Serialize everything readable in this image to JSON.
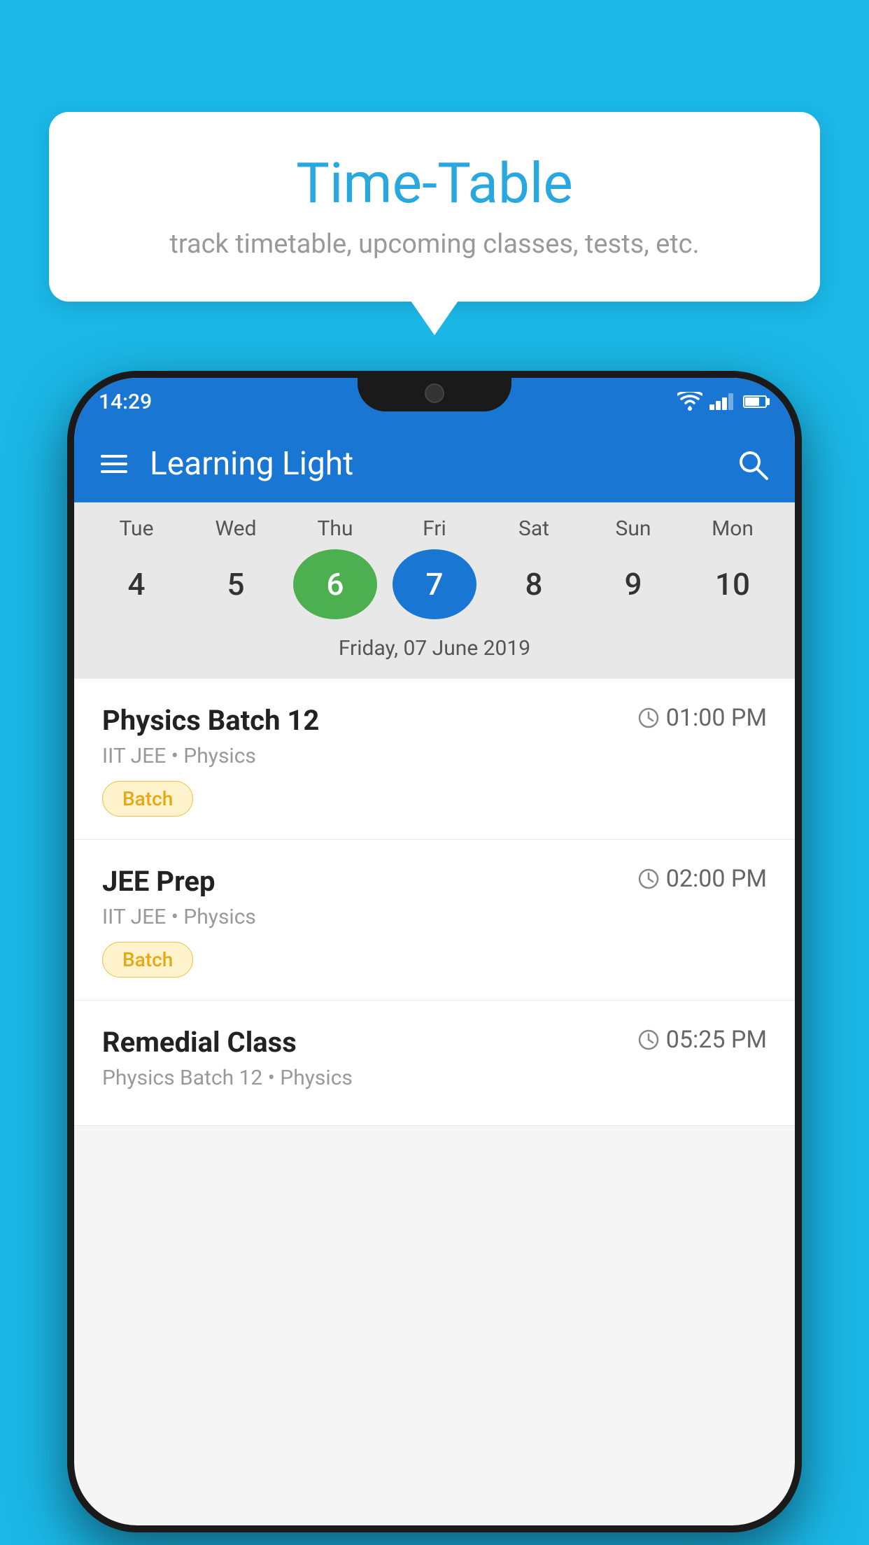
{
  "background_color": "#1BB8E8",
  "tooltip": {
    "title": "Time-Table",
    "subtitle": "track timetable, upcoming classes, tests, etc."
  },
  "app": {
    "name": "Learning Light",
    "status_time": "14:29"
  },
  "calendar": {
    "days": [
      {
        "label": "Tue",
        "number": "4"
      },
      {
        "label": "Wed",
        "number": "5"
      },
      {
        "label": "Thu",
        "number": "6",
        "state": "today"
      },
      {
        "label": "Fri",
        "number": "7",
        "state": "selected"
      },
      {
        "label": "Sat",
        "number": "8"
      },
      {
        "label": "Sun",
        "number": "9"
      },
      {
        "label": "Mon",
        "number": "10"
      }
    ],
    "selected_date": "Friday, 07 June 2019"
  },
  "schedule": [
    {
      "title": "Physics Batch 12",
      "time": "01:00 PM",
      "subtitle": "IIT JEE • Physics",
      "badge": "Batch"
    },
    {
      "title": "JEE Prep",
      "time": "02:00 PM",
      "subtitle": "IIT JEE • Physics",
      "badge": "Batch"
    },
    {
      "title": "Remedial Class",
      "time": "05:25 PM",
      "subtitle": "Physics Batch 12 • Physics",
      "badge": null
    }
  ]
}
